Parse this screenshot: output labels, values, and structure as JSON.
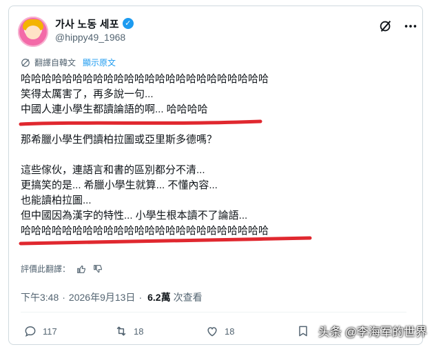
{
  "author": {
    "display_name": "가사 노동 세포",
    "handle": "@hippy49_1968"
  },
  "translation": {
    "label": "翻譯自韓文",
    "show_original": "顯示原文"
  },
  "tweet_lines": [
    "哈哈哈哈哈哈哈哈哈哈哈哈哈哈哈哈哈哈哈哈哈哈哈哈",
    "笑得太厲害了，再多說一句...",
    "中國人連小學生都讀論語的啊... 哈哈哈哈",
    "",
    "那希臘小學生們讀柏拉圖或亞里斯多德嗎？",
    "",
    "這些傢伙，連語言和書的區別都分不清...",
    "更搞笑的是... 希臘小學生就算... 不懂內容...",
    "也能讀柏拉圖...",
    "但中國因為漢字的特性... 小學生根本讀不了論語...",
    "哈哈哈哈哈哈哈哈哈哈哈哈哈哈哈哈哈哈哈哈哈哈哈哈"
  ],
  "rate_translation": "評價此翻譯：",
  "meta": {
    "time": "下午3:48",
    "date": "2026年9月13日",
    "separator": "·",
    "views_count": "6.2萬",
    "views_label": "次查看"
  },
  "actions": {
    "replies": "117",
    "reposts": "18",
    "likes": "18"
  },
  "watermark": "头条 @李海军的世界",
  "colors": {
    "accent": "#1d9bf0",
    "text": "#0f1419",
    "muted": "#536471",
    "red_underline": "#e0282f"
  }
}
